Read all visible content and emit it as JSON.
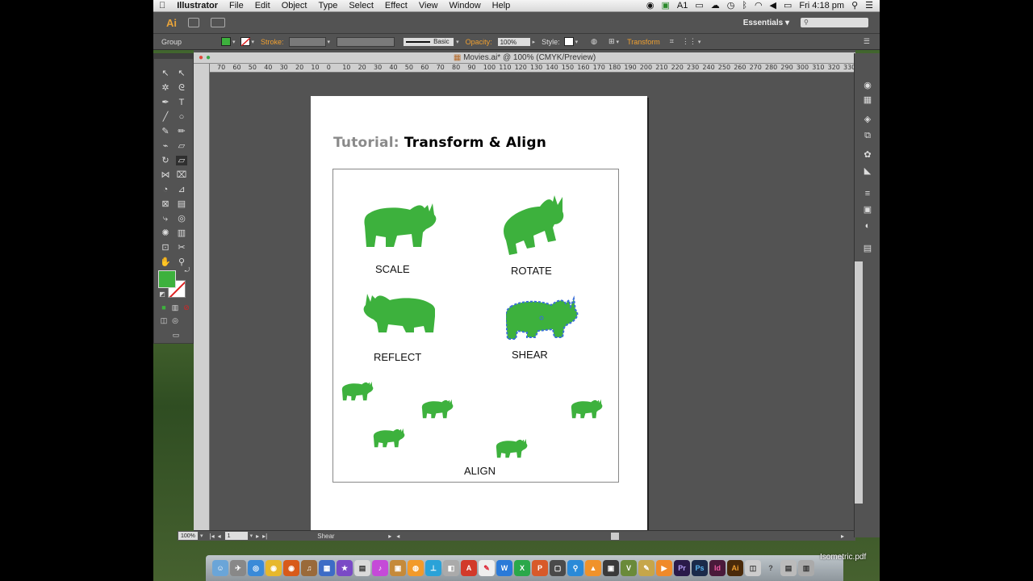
{
  "menubar": {
    "apple": "",
    "app_name": "Illustrator",
    "items": [
      "File",
      "Edit",
      "Object",
      "Type",
      "Select",
      "Effect",
      "View",
      "Window",
      "Help"
    ],
    "clock": "Fri 4:18 pm",
    "status_icons": [
      "record-icon",
      "evernote-icon",
      "adobe-1-icon",
      "airplay-icon",
      "time-machine-icon",
      "bluetooth-icon",
      "wifi-icon",
      "volume-icon",
      "battery-icon",
      "spotlight-icon",
      "list-icon"
    ],
    "adobe_badge": "1"
  },
  "appbar": {
    "logo": "Ai",
    "workspace": "Essentials",
    "workspace_caret": "▾"
  },
  "controlbar": {
    "selection": "Group",
    "stroke_label": "Stroke:",
    "stroke_style": "Basic",
    "opacity_label": "Opacity:",
    "opacity_value": "100%",
    "style_label": "Style:",
    "transform_label": "Transform",
    "fill_color": "#3db13d"
  },
  "document": {
    "tab_title": "Movies.ai* @ 100% (CMYK/Preview)",
    "ruler_labels": [
      "70",
      "60",
      "50",
      "40",
      "30",
      "20",
      "10",
      "0",
      "10",
      "20",
      "30",
      "40",
      "50",
      "60",
      "70",
      "80",
      "90",
      "100",
      "110",
      "120",
      "130",
      "140",
      "150",
      "160",
      "170",
      "180",
      "190",
      "200",
      "210",
      "220",
      "230",
      "240",
      "250",
      "260",
      "270",
      "280",
      "290",
      "300",
      "310",
      "320",
      "330"
    ]
  },
  "artboard": {
    "title_prefix": "Tutorial: ",
    "title_main": "Transform & Align",
    "captions": {
      "scale": "SCALE",
      "rotate": "ROTATE",
      "reflect": "REFLECT",
      "shear": "SHEAR",
      "align": "ALIGN"
    },
    "shape_color": "#3db13d",
    "selection_color": "#3a6fd8"
  },
  "statusbar": {
    "zoom": "100%",
    "artboard_num": "1",
    "current_tool": "Shear"
  },
  "macdock": {
    "file_label": "Isometric.pdf",
    "apps": [
      "Finder",
      "Launchpad",
      "Safari",
      "Chrome",
      "Firefox",
      "Guitar",
      "Keynote",
      "Pages",
      "iTunes",
      "Preview",
      "Maps",
      "Numbers",
      "Photo",
      "Acrobat",
      "Word",
      "Excel",
      "PowerPoint",
      "Vectorworks",
      "VLC",
      "Illustrator-old",
      "Pencil",
      "Media",
      "Premiere",
      "Photoshop",
      "InDesign",
      "Illustrator",
      "Preview2",
      "Help",
      "Utilities",
      "Trash"
    ]
  }
}
